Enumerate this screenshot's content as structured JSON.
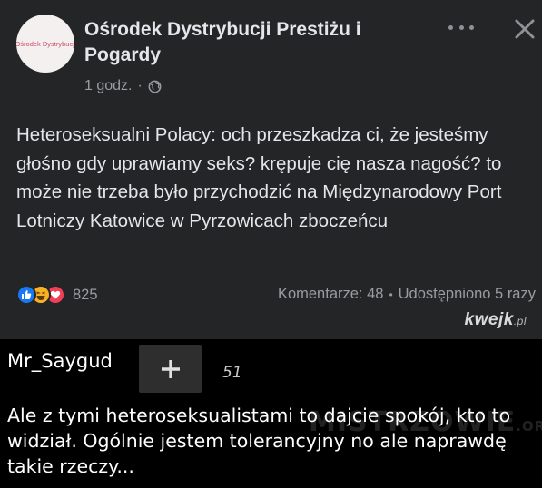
{
  "post": {
    "avatar_text": "Ośrodek Dystrybucji",
    "page_name": "Ośrodek Dystrybucji Prestiżu i Pogardy",
    "time": "1 godz.",
    "separator": "·",
    "body": "Heteroseksualni Polacy: och przeszkadza ci, że jesteśmy głośno gdy uprawiamy seks? krępuje cię nasza nagość? to może nie trzeba było przychodzić na Międzynarodowy Port Lotniczy Katowice w Pyrzowicach zboczeńcu",
    "reactions_count": "825",
    "comments": "Komentarze: 48",
    "stats_separator": "•",
    "shares": "Udostępniono 5 razy"
  },
  "site_logo": {
    "main": "kwejk",
    "suffix": ".pl"
  },
  "comment": {
    "username": "Mr_Saygud",
    "score": "51",
    "text": "Ale z tymi heteroseksualistami to dajcie spokój, kto to widział. Ogólnie jestem tolerancyjny no ale naprawdę takie rzeczy...",
    "watermark": "MISTRZOWIE",
    "watermark_suffix": ".ORG"
  },
  "colors": {
    "post_background": "#242526",
    "like": "#1877f2",
    "haha": "#f7b125",
    "love": "#f33e58",
    "comment_background": "#000000"
  },
  "icons": {
    "globe": "globe-icon",
    "more": "more-icon",
    "close": "close-icon",
    "plus": "plus-icon"
  }
}
